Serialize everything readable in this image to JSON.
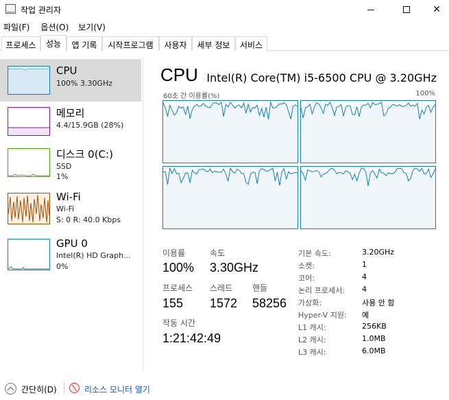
{
  "window": {
    "title": "작업 관리자"
  },
  "menu": [
    "파일(F)",
    "옵션(O)",
    "보기(V)"
  ],
  "tabs": [
    "프로세스",
    "성능",
    "앱 기록",
    "시작프로그램",
    "사용자",
    "세부 정보",
    "서비스"
  ],
  "sidebar": [
    {
      "title": "CPU",
      "line1": "100% 3.30GHz",
      "line2": "",
      "color": "#117dbb"
    },
    {
      "title": "메모리",
      "line1": "4.4/15.9GB (28%)",
      "line2": "",
      "color": "#8b12ae"
    },
    {
      "title": "디스크 0(C:)",
      "line1": "SSD",
      "line2": "1%",
      "color": "#4da60c"
    },
    {
      "title": "Wi-Fi",
      "line1": "Wi-Fi",
      "line2": "S: 0 R: 40.0 Kbps",
      "color": "#a74f01"
    },
    {
      "title": "GPU 0",
      "line1": "Intel(R) HD Graph...",
      "line2": "0%",
      "color": "#117dbb"
    }
  ],
  "cpu": {
    "heading": "CPU",
    "model": "Intel(R) Core(TM) i5-6500 CPU @ 3.20GHz",
    "graph_label": "60초 간 이용률(%)",
    "graph_max": "100%",
    "stats": {
      "utilization_label": "이용률",
      "utilization": "100%",
      "speed_label": "속도",
      "speed": "3.30GHz",
      "processes_label": "프로세스",
      "processes": "155",
      "threads_label": "스레드",
      "threads": "1572",
      "handles_label": "핸들",
      "handles": "58256",
      "uptime_label": "작동 시간",
      "uptime": "1:21:42:49"
    },
    "properties": [
      {
        "label": "기본 속도:",
        "value": "3.20GHz"
      },
      {
        "label": "소켓:",
        "value": "1"
      },
      {
        "label": "코어:",
        "value": "4"
      },
      {
        "label": "논리 프로세서:",
        "value": "4"
      },
      {
        "label": "가상화:",
        "value": "사용 안 함"
      },
      {
        "label": "Hyper-V 지원:",
        "value": "예"
      },
      {
        "label": "L1 캐시:",
        "value": "256KB"
      },
      {
        "label": "L2 캐시:",
        "value": "1.0MB"
      },
      {
        "label": "L3 캐시:",
        "value": "6.0MB"
      }
    ]
  },
  "footer": {
    "less": "간단히(D)",
    "resmon": "리소스 모니터 열기"
  }
}
